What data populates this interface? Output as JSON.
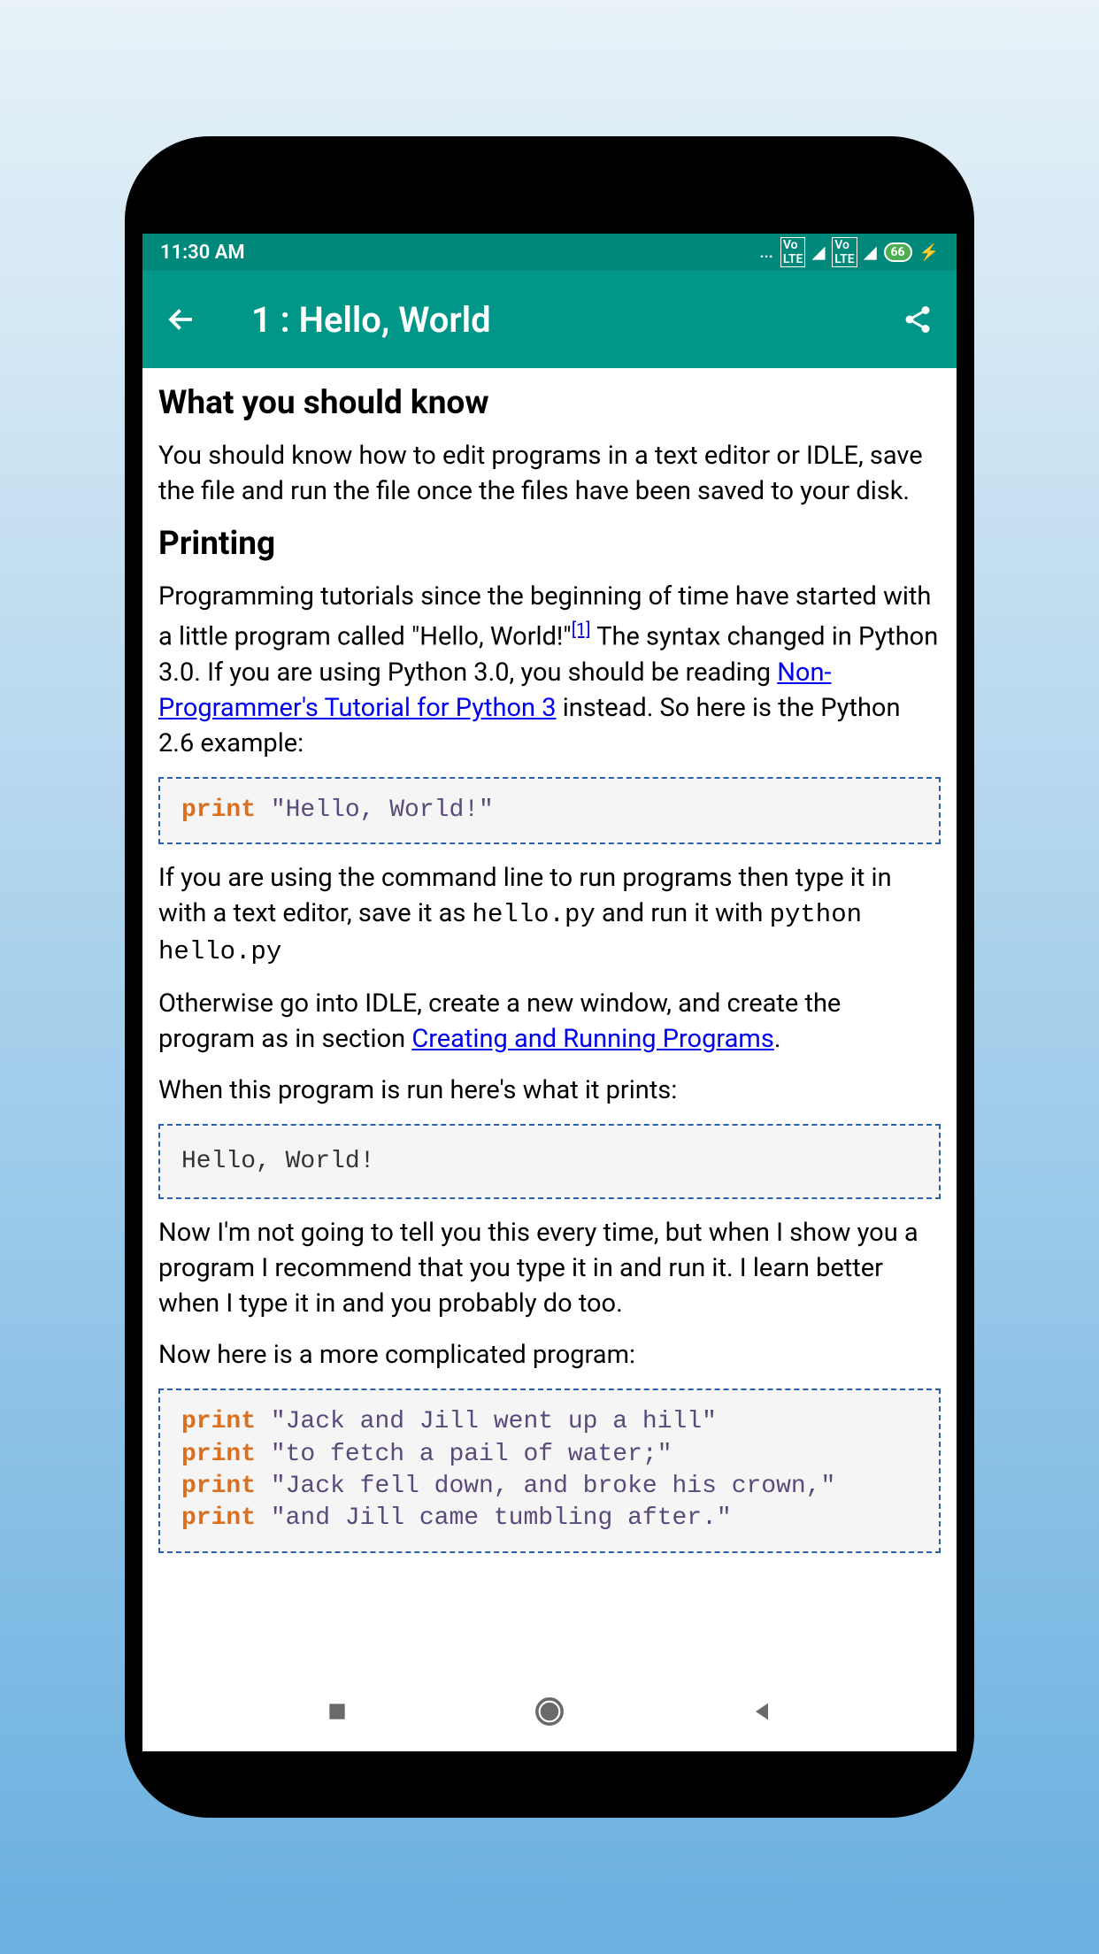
{
  "status_bar": {
    "time": "11:30 AM",
    "battery": "66",
    "icons": "... ⬚ ◢ ⬚ ◢"
  },
  "app_bar": {
    "title": "1 : Hello, World"
  },
  "content": {
    "section1": {
      "heading": "What you should know",
      "paragraph": "You should know how to edit programs in a text editor or IDLE, save the file and run the file once the files have been saved to your disk."
    },
    "section2": {
      "heading": "Printing",
      "para1_part1": "Programming tutorials since the beginning of time have started with a little program called \"Hello, World!\"",
      "para1_ref": "[1]",
      "para1_part2": " The syntax changed in Python 3.0. If you are using Python 3.0, you should be reading ",
      "link1": "Non-Programmer's Tutorial for Python 3",
      "para1_part3": " instead. So here is the Python 2.6 example:",
      "code1_keyword": "print",
      "code1_string": " \"Hello, World!\"",
      "para2_part1": "If you are using the command line to run programs then type it in with a text editor, save it as ",
      "para2_code1": "hello.py",
      "para2_part2": " and run it with ",
      "para2_code2": "python hello.py",
      "para3_part1": "Otherwise go into IDLE, create a new window, and create the program as in section ",
      "link2": "Creating and Running Programs",
      "para3_part2": ".",
      "para4": "When this program is run here's what it prints:",
      "output1": "Hello, World!",
      "para5": "Now I'm not going to tell you this every time, but when I show you a program I recommend that you type it in and run it. I learn better when I type it in and you probably do too.",
      "para6": "Now here is a more complicated program:",
      "code2_lines": [
        {
          "keyword": "print",
          "string": " \"Jack and Jill went up a hill\""
        },
        {
          "keyword": "print",
          "string": " \"to fetch a pail of water;\""
        },
        {
          "keyword": "print",
          "string": " \"Jack fell down, and broke his crown,\""
        },
        {
          "keyword": "print",
          "string": " \"and Jill came tumbling after.\""
        }
      ]
    }
  }
}
